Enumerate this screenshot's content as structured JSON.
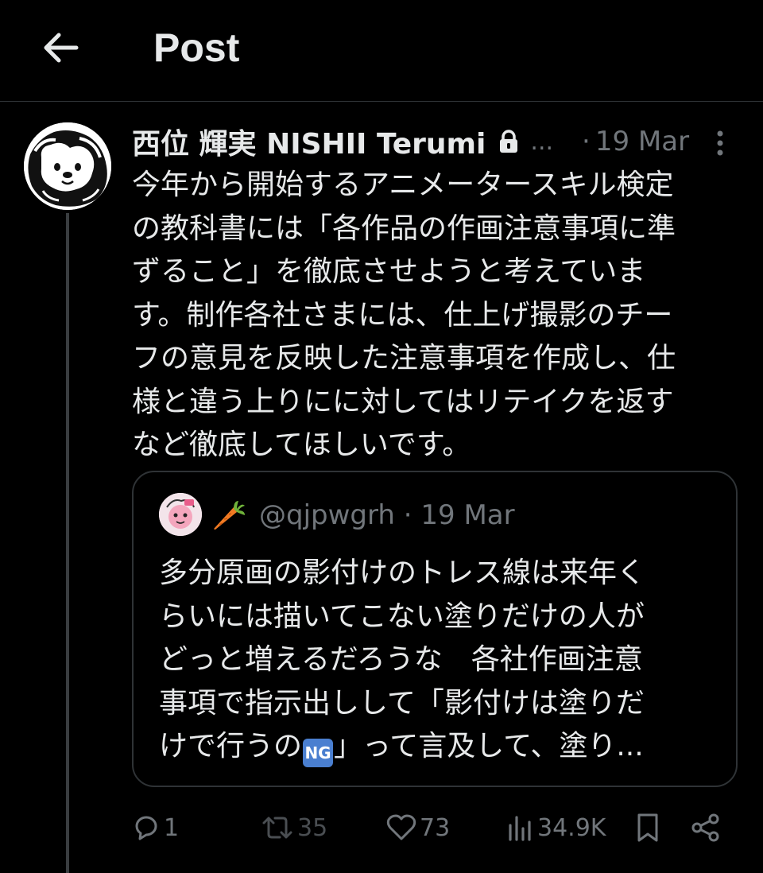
{
  "header": {
    "title": "Post"
  },
  "post": {
    "author_name": "西位 輝実 NISHII Terumi",
    "ellipsis": "...",
    "separator": "·",
    "date": "19 Mar",
    "text_lines": [
      "今年から開始するアニメータースキル検定",
      "の教科書には「各作品の作画注意事項に準",
      "ずること」を徹底させようと考えていま",
      "す。制作各社さまには、仕上げ撮影のチー",
      "フの意見を反映した注意事項を作成し、仕",
      "様と違う上りにに対してはリテイクを返す",
      "など徹底してほしいです。"
    ]
  },
  "quote": {
    "emoji": "🥕",
    "handle": "@qjpwgrh",
    "separator": "·",
    "date": "19 Mar",
    "text_lines": [
      "多分原画の影付けのトレス線は来年く",
      "らいには描いてこない塗りだけの人が",
      "どっと増えるだろうな　各社作画注意",
      "事項で指示出しして「影付けは塗りだ"
    ],
    "last_line_before": "けで行うの",
    "ng_badge": "NG",
    "last_line_after": "」って言及して、塗り..."
  },
  "actions": {
    "replies": "1",
    "reposts": "35",
    "likes": "73",
    "views": "34.9K"
  },
  "colors": {
    "background": "#000000",
    "text": "#e7e9ea",
    "muted": "#71767b",
    "border": "#2f3336"
  }
}
